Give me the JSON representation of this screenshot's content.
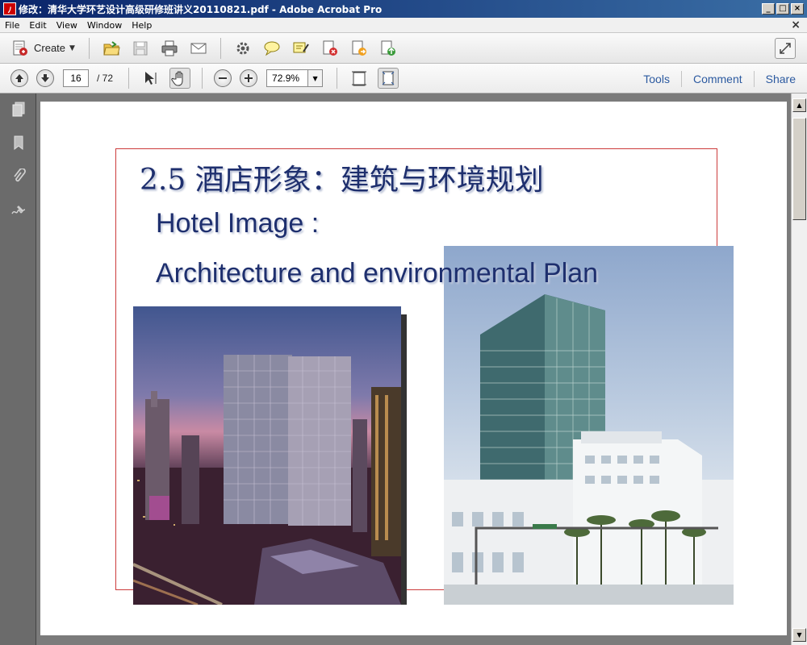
{
  "window": {
    "title": "修改：清华大学环艺设计高级研修班讲义20110821.pdf - Adobe Acrobat Pro",
    "app_icon": "pdf-icon",
    "controls": [
      "_",
      "□",
      "×"
    ]
  },
  "menu": {
    "items": [
      "File",
      "Edit",
      "View",
      "Window",
      "Help"
    ],
    "close": "×"
  },
  "toolbar": {
    "create_label": "Create",
    "icons": [
      "open-folder-icon",
      "save-icon",
      "print-icon",
      "email-icon",
      "settings-icon",
      "comment-icon",
      "highlight-icon",
      "delete-page-icon",
      "export-icon",
      "share-export-icon"
    ]
  },
  "nav": {
    "current_page": "16",
    "total_pages": "/ 72",
    "zoom": "72.9%",
    "links": [
      "Tools",
      "Comment",
      "Share"
    ]
  },
  "slide": {
    "title": "2.5 酒店形象：建筑与环境规划",
    "subtitle_line1": "Hotel Image :",
    "subtitle_line2": "Architecture and environmental Plan"
  },
  "colors": {
    "title_text": "#1e2f6e",
    "frame_border": "#cc3b3b",
    "link_blue": "#2c5aa0"
  }
}
